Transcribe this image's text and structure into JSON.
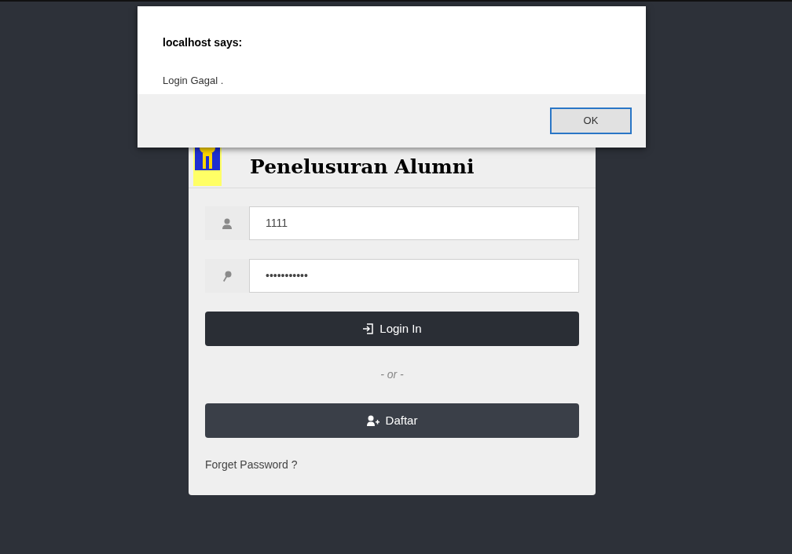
{
  "dialog": {
    "title": "localhost says:",
    "message": "Login Gagal .",
    "buttons": [
      "OK"
    ]
  },
  "login": {
    "title": "Penelusuran Alumni",
    "fields": [
      {
        "kind": "user",
        "value": "1111"
      },
      {
        "kind": "password",
        "value": "•••••••••••"
      }
    ],
    "login_button": "Login In",
    "separator": "- or -",
    "register_button": "Daftar",
    "forgot_link": "Forget Password ?"
  }
}
